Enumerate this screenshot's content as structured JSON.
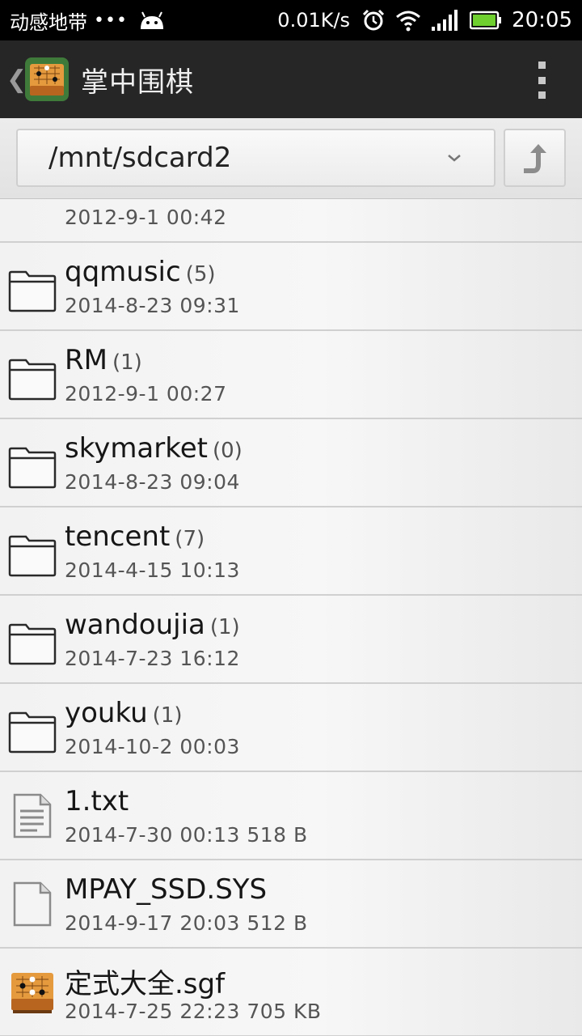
{
  "status_bar": {
    "carrier": "动感地带",
    "dots": "•••",
    "net_speed": "0.01K/s",
    "time": "20:05",
    "battery_color": "#6ecf2f"
  },
  "action_bar": {
    "back_glyph": "❮",
    "title": "掌中围棋",
    "background": "#262626"
  },
  "path_bar": {
    "path": "/mnt/sdcard2"
  },
  "files": [
    {
      "type": "folder",
      "name": "",
      "count": "",
      "meta": "2012-9-1 00:42",
      "partial": true
    },
    {
      "type": "folder",
      "name": "qqmusic",
      "count": "(5)",
      "meta": "2014-8-23 09:31"
    },
    {
      "type": "folder",
      "name": "RM",
      "count": "(1)",
      "meta": "2012-9-1 00:27"
    },
    {
      "type": "folder",
      "name": "skymarket",
      "count": "(0)",
      "meta": "2014-8-23 09:04"
    },
    {
      "type": "folder",
      "name": "tencent",
      "count": "(7)",
      "meta": "2014-4-15 10:13"
    },
    {
      "type": "folder",
      "name": "wandoujia",
      "count": "(1)",
      "meta": "2014-7-23 16:12"
    },
    {
      "type": "folder",
      "name": "youku",
      "count": "(1)",
      "meta": "2014-10-2 00:03"
    },
    {
      "type": "text-file",
      "name": "1.txt",
      "count": "",
      "meta": "2014-7-30 00:13  518 B"
    },
    {
      "type": "blank-file",
      "name": "MPAY_SSD.SYS",
      "count": "",
      "meta": "2014-9-17 20:03  512 B"
    },
    {
      "type": "sgf-file",
      "name": "定式大全.sgf",
      "count": "",
      "meta": "2014-7-25 22:23  705 KB"
    }
  ]
}
